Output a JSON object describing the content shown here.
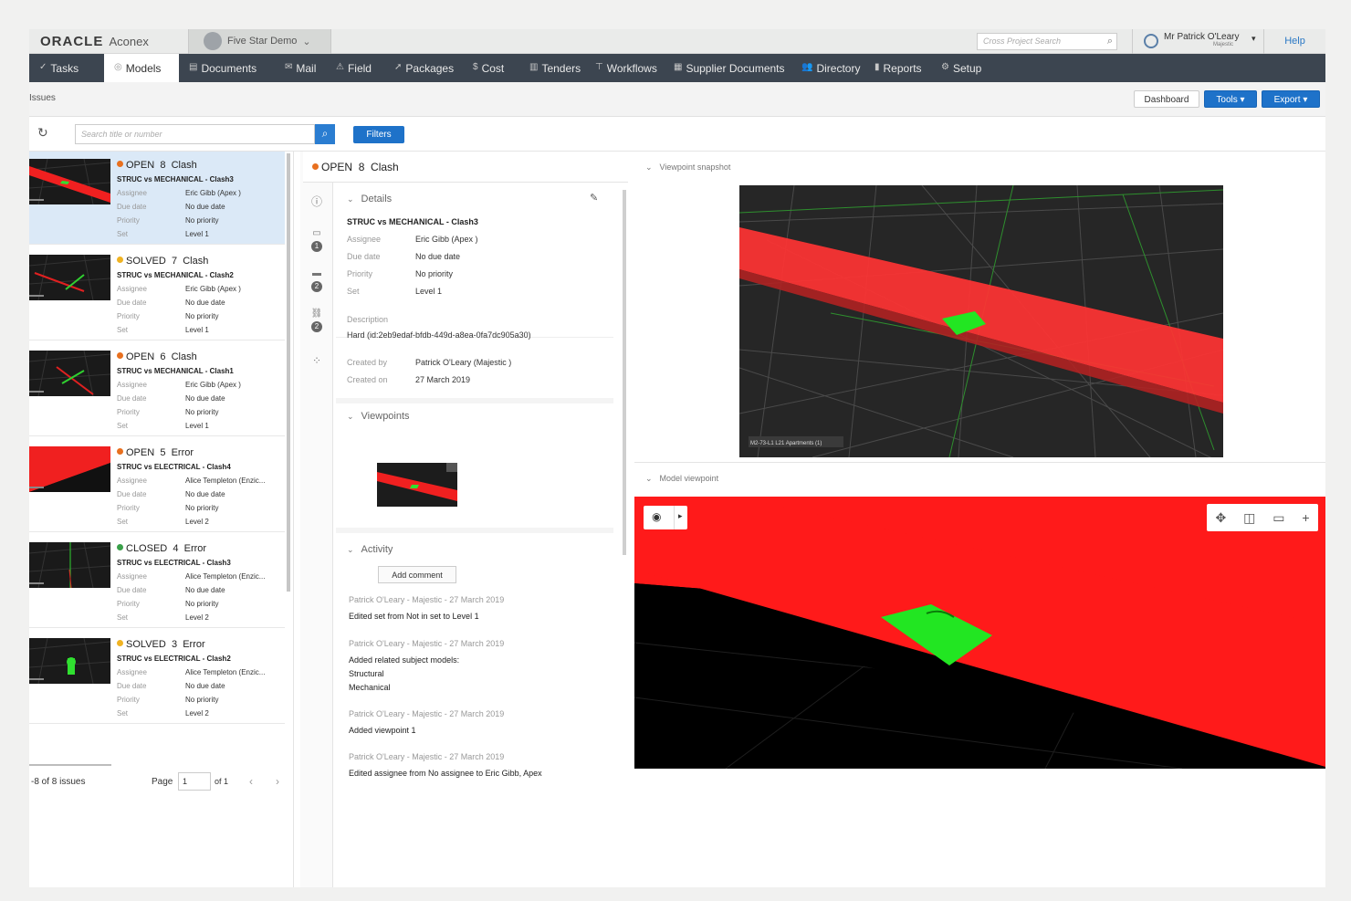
{
  "topbar": {
    "brand": "ORACLE",
    "product": "Aconex",
    "project": "Five Star Demo",
    "cross_search_placeholder": "Cross Project Search",
    "user_name": "Mr Patrick O'Leary",
    "user_org": "Majestic",
    "help": "Help"
  },
  "nav": {
    "items": [
      {
        "label": "Tasks",
        "icon": "✓"
      },
      {
        "label": "Models",
        "icon": "◎"
      },
      {
        "label": "Documents",
        "icon": "▤"
      },
      {
        "label": "Mail",
        "icon": "✉"
      },
      {
        "label": "Field",
        "icon": "⚠"
      },
      {
        "label": "Packages",
        "icon": "➚"
      },
      {
        "label": "Cost",
        "icon": "$"
      },
      {
        "label": "Tenders",
        "icon": "▥"
      },
      {
        "label": "Workflows",
        "icon": "⊤"
      },
      {
        "label": "Supplier Documents",
        "icon": "▦"
      },
      {
        "label": "Directory",
        "icon": "👥"
      },
      {
        "label": "Reports",
        "icon": "▮"
      },
      {
        "label": "Setup",
        "icon": "⚙"
      }
    ],
    "active_index": 1
  },
  "page": {
    "breadcrumb": "Issues",
    "dashboard": "Dashboard",
    "tools": "Tools ▾",
    "export": "Export ▾"
  },
  "toolbar": {
    "search_placeholder": "Search title or number",
    "filters": "Filters"
  },
  "labels": {
    "assignee": "Assignee",
    "due_date": "Due date",
    "priority": "Priority",
    "set": "Set"
  },
  "issues": [
    {
      "status": "OPEN",
      "status_color": "#e8701f",
      "number": "8",
      "type": "Clash",
      "title": "STRUC vs MECHANICAL - Clash3",
      "assignee": "Eric Gibb (Apex )",
      "due": "No due date",
      "priority": "No priority",
      "set": "Level 1"
    },
    {
      "status": "SOLVED",
      "status_color": "#f0b323",
      "number": "7",
      "type": "Clash",
      "title": "STRUC vs MECHANICAL - Clash2",
      "assignee": "Eric Gibb (Apex )",
      "due": "No due date",
      "priority": "No priority",
      "set": "Level 1"
    },
    {
      "status": "OPEN",
      "status_color": "#e8701f",
      "number": "6",
      "type": "Clash",
      "title": "STRUC vs MECHANICAL - Clash1",
      "assignee": "Eric Gibb (Apex )",
      "due": "No due date",
      "priority": "No priority",
      "set": "Level 1"
    },
    {
      "status": "OPEN",
      "status_color": "#e8701f",
      "number": "5",
      "type": "Error",
      "title": "STRUC vs ELECTRICAL - Clash4",
      "assignee": "Alice Templeton (Enzic...",
      "due": "No due date",
      "priority": "No priority",
      "set": "Level 2"
    },
    {
      "status": "CLOSED",
      "status_color": "#3aa04a",
      "number": "4",
      "type": "Error",
      "title": "STRUC vs ELECTRICAL - Clash3",
      "assignee": "Alice Templeton (Enzic...",
      "due": "No due date",
      "priority": "No priority",
      "set": "Level 2"
    },
    {
      "status": "SOLVED",
      "status_color": "#f0b323",
      "number": "3",
      "type": "Error",
      "title": "STRUC vs ELECTRICAL - Clash2",
      "assignee": "Alice Templeton (Enzic...",
      "due": "No due date",
      "priority": "No priority",
      "set": "Level 2"
    }
  ],
  "pager": {
    "count": "-8 of 8 issues",
    "page_label": "Page",
    "page_value": "1",
    "of": "of 1"
  },
  "detail": {
    "status": "OPEN",
    "number": "8",
    "type": "Clash",
    "details_heading": "Details",
    "title": "STRUC vs MECHANICAL - Clash3",
    "assignee": "Eric Gibb (Apex )",
    "due": "No due date",
    "priority": "No priority",
    "set": "Level 1",
    "description_label": "Description",
    "description": "Hard (id:2eb9edaf-bfdb-449d-a8ea-0fa7dc905a30)",
    "created_by_label": "Created by",
    "created_by": "Patrick O'Leary (Majestic )",
    "created_on_label": "Created on",
    "created_on": "27 March 2019",
    "viewpoints_heading": "Viewpoints",
    "activity_heading": "Activity",
    "add_comment": "Add comment",
    "activity": [
      {
        "meta": "Patrick O'Leary - Majestic - 27 March 2019",
        "text": [
          "Edited set from Not in set to Level 1"
        ]
      },
      {
        "meta": "Patrick O'Leary - Majestic - 27 March 2019",
        "text": [
          "Added related subject models:",
          "Structural",
          "Mechanical"
        ]
      },
      {
        "meta": "Patrick O'Leary - Majestic - 27 March 2019",
        "text": [
          "Added viewpoint 1"
        ]
      },
      {
        "meta": "Patrick O'Leary - Majestic - 27 March 2019",
        "text": [
          "Edited assignee from No assignee to Eric Gibb, Apex"
        ]
      }
    ]
  },
  "rail": {
    "badge1": "1",
    "badge2": "2",
    "badge3": "2"
  },
  "right": {
    "snapshot_heading": "Viewpoint snapshot",
    "snapshot_caption": "M2-73-L1 L21 Apartments (1)",
    "model_heading": "Model viewpoint"
  },
  "colors": {
    "nav_bg": "#3c4550",
    "accent_blue": "#1e72c9",
    "clash_red": "#ff1a1a",
    "clash_green": "#22e622"
  }
}
